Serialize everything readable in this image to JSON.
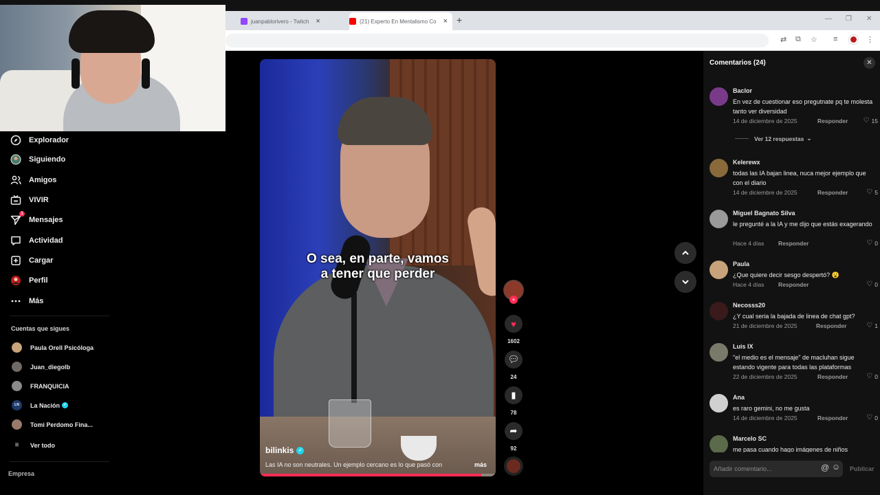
{
  "browser": {
    "tabs": [
      {
        "title": "juanpablorivero - Twitch",
        "favicon_color": "#9146ff"
      },
      {
        "title": "(21) Experto En Mentalismo Co",
        "favicon_color": "#ff0000"
      }
    ],
    "new_tab": "+",
    "tab_close": "×",
    "minimize": "—",
    "restore": "❐",
    "close": "✕"
  },
  "nav": {
    "items": [
      {
        "label": "Explorador",
        "icon": "compass-icon"
      },
      {
        "label": "Siguiendo",
        "icon": "avatar-icon"
      },
      {
        "label": "Amigos",
        "icon": "people-icon"
      },
      {
        "label": "VIVIR",
        "icon": "tv-icon"
      },
      {
        "label": "Mensajes",
        "icon": "send-icon",
        "badge": "1"
      },
      {
        "label": "Actividad",
        "icon": "message-icon"
      },
      {
        "label": "Cargar",
        "icon": "plus-square-icon"
      },
      {
        "label": "Perfil",
        "icon": "profile-icon"
      },
      {
        "label": "Más",
        "icon": "more-icon"
      }
    ],
    "following_title": "Cuentas que sigues",
    "following": [
      {
        "name": "Paula Orell Psicóloga",
        "verified": false
      },
      {
        "name": "Juan_diegolb",
        "verified": false
      },
      {
        "name": "FRANQUICIA",
        "verified": false
      },
      {
        "name": "La Nación",
        "verified": true
      },
      {
        "name": "Tomi Perdomo Fina...",
        "verified": false
      }
    ],
    "see_all": "Ver todo",
    "company": "Empresa"
  },
  "video": {
    "caption_line1": "O sea, en parte, vamos",
    "caption_line2": "a tener que perder",
    "author": "bilinkis",
    "description": "Las IA no son neutrales. Un ejemplo cercano es lo que pasó con",
    "more": "más",
    "progress": 0.94
  },
  "actions": {
    "likes": "1602",
    "comments": "24",
    "saves": "78",
    "shares": "92",
    "follow_plus": "+"
  },
  "comments_panel": {
    "title": "Comentarios",
    "count": "(24)",
    "reply_label": "Responder",
    "view_replies": "Ver 12 respuestas",
    "input_placeholder": "Añadir comentario...",
    "post": "Publicar",
    "items": [
      {
        "user": "Baclor",
        "text": "En vez de cuestionar eso pregutnate pq te molesta tanto ver diversidad",
        "date": "14 de diciembre de 2025",
        "likes": "15",
        "avatar_color": "#7a3a8a"
      },
      {
        "user": "Kelerewx",
        "text": "todas las IA bajan linea, nuca mejor ejemplo que con el diario",
        "date": "14 de diciembre de 2025",
        "likes": "5",
        "avatar_color": "#8a6a3a"
      },
      {
        "user": "Miguel Bagnato Silva",
        "text": "le pregunté a la IA y me dijo que estás exagerando",
        "date": "Hace 4 días",
        "likes": "0",
        "avatar_color": "#9a9a9a"
      },
      {
        "user": "Paula",
        "text": "¿Que quiere decir sesgo despertó? 😮",
        "date": "Hace 4 días",
        "likes": "0",
        "avatar_color": "#c8a27a"
      },
      {
        "user": "Necosss20",
        "text": "¿Y cual seria la bajada de linea de chat gpt?",
        "date": "21 de diciembre de 2025",
        "likes": "1",
        "avatar_color": "#3a1a1a"
      },
      {
        "user": "Luis IX",
        "text": "\"el medio es el mensaje\" de macluhan sigue estando vigente para todas las plataformas",
        "date": "22 de diciembre de 2025",
        "likes": "0",
        "avatar_color": "#7a7a6a"
      },
      {
        "user": "Ana",
        "text": "es raro gemini, no me gusta",
        "date": "14 de diciembre de 2025",
        "likes": "0",
        "avatar_color": "#d0d0d0"
      },
      {
        "user": "Marcelo SC",
        "text": "me pasa cuando hago imágenes de niños",
        "date": "",
        "likes": "",
        "avatar_color": "#5a6a4a"
      }
    ]
  }
}
